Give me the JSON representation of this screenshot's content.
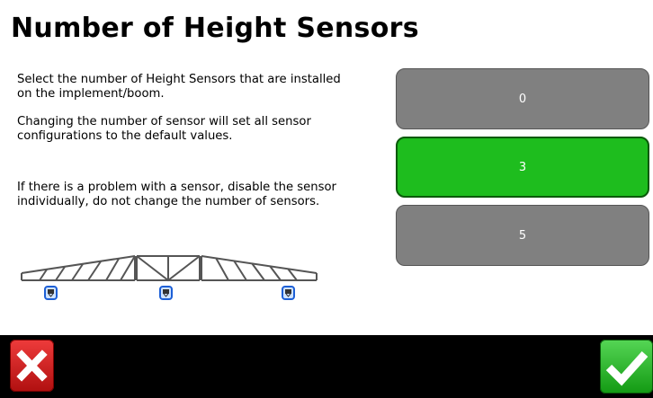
{
  "page": {
    "title": "Number of Height Sensors",
    "paragraphs": [
      "Select the number of Height Sensors that are installed on the implement/boom.",
      "Changing the number of sensor will set all sensor configurations to the default values.",
      "If there is a problem with a sensor, disable the sensor individually, do not change the number of sensors."
    ]
  },
  "options": [
    {
      "label": "0",
      "selected": false
    },
    {
      "label": "3",
      "selected": true
    },
    {
      "label": "5",
      "selected": false
    }
  ],
  "illustration": {
    "sensor_count": 3,
    "sensor_icon": "height-sensor-icon"
  },
  "footer": {
    "cancel_icon": "close-icon",
    "accept_icon": "checkmark-icon"
  },
  "colors": {
    "selected": "#1ebd1e",
    "unselected": "#808080",
    "cancel": "#d42222",
    "accept": "#2bb52b"
  }
}
